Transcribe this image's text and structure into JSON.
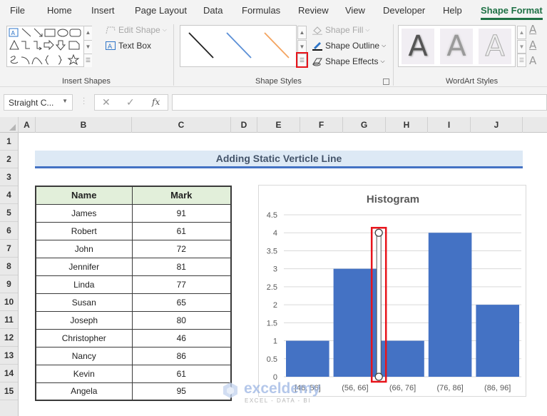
{
  "menu": {
    "tabs": [
      {
        "label": "File",
        "active": false
      },
      {
        "label": "Home",
        "active": false
      },
      {
        "label": "Insert",
        "active": false
      },
      {
        "label": "Page Layout",
        "active": false
      },
      {
        "label": "Data",
        "active": false
      },
      {
        "label": "Formulas",
        "active": false
      },
      {
        "label": "Review",
        "active": false
      },
      {
        "label": "View",
        "active": false
      },
      {
        "label": "Developer",
        "active": false
      },
      {
        "label": "Help",
        "active": false
      },
      {
        "label": "Shape Format",
        "active": true
      }
    ]
  },
  "ribbon": {
    "insert_shapes": {
      "label": "Insert Shapes",
      "edit_shape": "Edit Shape",
      "text_box": "Text Box",
      "shape_icons": [
        "text-box-shape",
        "line-shape",
        "arrow-line-shape",
        "rectangle-shape",
        "oval-shape",
        "rounded-rectangle-shape",
        "triangle-shape",
        "elbow-connector-shape",
        "elbow-arrow-connector-shape",
        "right-arrow-shape",
        "down-arrow-shape",
        "snip-rectangle-shape",
        "freeform-shape",
        "arc-shape",
        "curve-shape",
        "left-brace-shape",
        "right-brace-shape",
        "star-shape"
      ]
    },
    "shape_styles": {
      "label": "Shape Styles",
      "presets": [
        {
          "name": "black-line-style",
          "color": "#222222"
        },
        {
          "name": "blue-line-style",
          "color": "#5b8fd6"
        },
        {
          "name": "orange-line-style",
          "color": "#f4a460"
        }
      ],
      "shape_fill": "Shape Fill",
      "shape_outline": "Shape Outline",
      "shape_effects": "Shape Effects"
    },
    "wordart_styles": {
      "label": "WordArt Styles",
      "sample": "A"
    }
  },
  "formula_bar": {
    "name_box": "Straight C...",
    "cancel": "✕",
    "enter": "✓",
    "fx": "fx",
    "value": ""
  },
  "sheet": {
    "columns": [
      "A",
      "B",
      "C",
      "D",
      "E",
      "F",
      "G",
      "H",
      "I",
      "J"
    ],
    "rows": [
      "1",
      "2",
      "3",
      "4",
      "5",
      "6",
      "7",
      "8",
      "9",
      "10",
      "11",
      "12",
      "13",
      "14",
      "15"
    ],
    "title": "Adding Static Verticle Line",
    "table": {
      "headers": [
        "Name",
        "Mark"
      ],
      "rows": [
        [
          "James",
          "91"
        ],
        [
          "Robert",
          "61"
        ],
        [
          "John",
          "72"
        ],
        [
          "Jennifer",
          "81"
        ],
        [
          "Linda",
          "77"
        ],
        [
          "Susan",
          "65"
        ],
        [
          "Joseph",
          "80"
        ],
        [
          "Christopher",
          "46"
        ],
        [
          "Nancy",
          "86"
        ],
        [
          "Kevin",
          "61"
        ],
        [
          "Angela",
          "95"
        ]
      ]
    }
  },
  "chart_data": {
    "type": "bar",
    "title": "Histogram",
    "categories": [
      "[46, 56]",
      "(56, 66]",
      "(66, 76]",
      "(76, 86]",
      "(86, 96]"
    ],
    "values": [
      1,
      3,
      1,
      4,
      2
    ],
    "ylim": [
      0,
      4.5
    ],
    "yticks": [
      "0",
      "0.5",
      "1",
      "1.5",
      "2",
      "2.5",
      "3",
      "3.5",
      "4",
      "4.5"
    ],
    "xlabel": "",
    "ylabel": "",
    "grid": true,
    "bar_color": "#4472c4",
    "vertical_line": {
      "between_categories": [
        1,
        2
      ],
      "y_from": 0,
      "y_to": 4,
      "selected": true
    }
  },
  "watermark": {
    "name": "exceldemy",
    "tagline": "EXCEL - DATA - BI"
  }
}
